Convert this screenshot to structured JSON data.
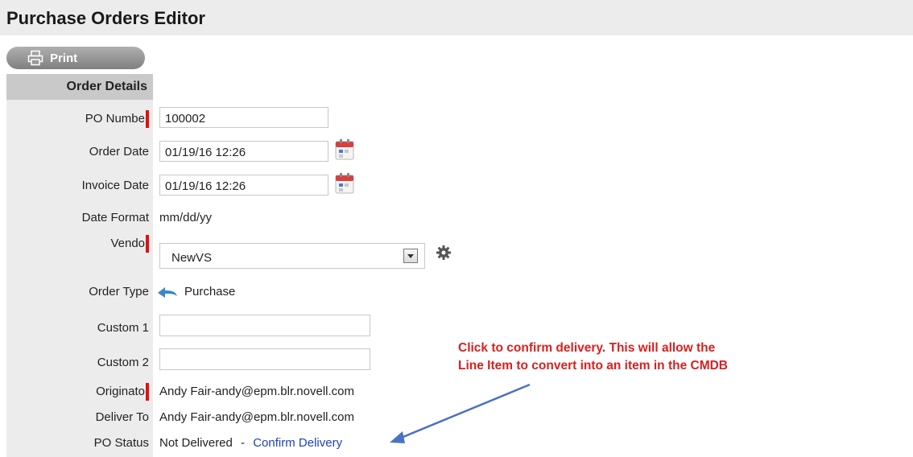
{
  "header": {
    "title": "Purchase Orders Editor"
  },
  "toolbar": {
    "print_label": "Print"
  },
  "section": {
    "title": "Order Details"
  },
  "fields": {
    "po_number": {
      "label": "PO Number",
      "value": "100002"
    },
    "order_date": {
      "label": "Order Date",
      "value": "01/19/16 12:26"
    },
    "invoice_date": {
      "label": "Invoice Date",
      "value": "01/19/16 12:26"
    },
    "date_format": {
      "label": "Date Format",
      "value": "mm/dd/yy"
    },
    "vendor": {
      "label": "Vendor",
      "value": "NewVS"
    },
    "order_type": {
      "label": "Order Type",
      "value": "Purchase"
    },
    "custom1": {
      "label": "Custom 1",
      "value": ""
    },
    "custom2": {
      "label": "Custom 2",
      "value": ""
    },
    "originator": {
      "label": "Originator",
      "value": "Andy Fair-andy@epm.blr.novell.com"
    },
    "deliver_to": {
      "label": "Deliver To",
      "value": "Andy Fair-andy@epm.blr.novell.com"
    },
    "po_status": {
      "label": "PO Status",
      "value": "Not Delivered",
      "separator": "-",
      "link": "Confirm Delivery"
    }
  },
  "annotation": {
    "line1": "Click to confirm delivery. This will allow the",
    "line2": "Line Item to convert into an item in the CMDB"
  },
  "colors": {
    "annotation": "#d9201f",
    "link": "#1f3fbf",
    "required": "#d11111"
  }
}
